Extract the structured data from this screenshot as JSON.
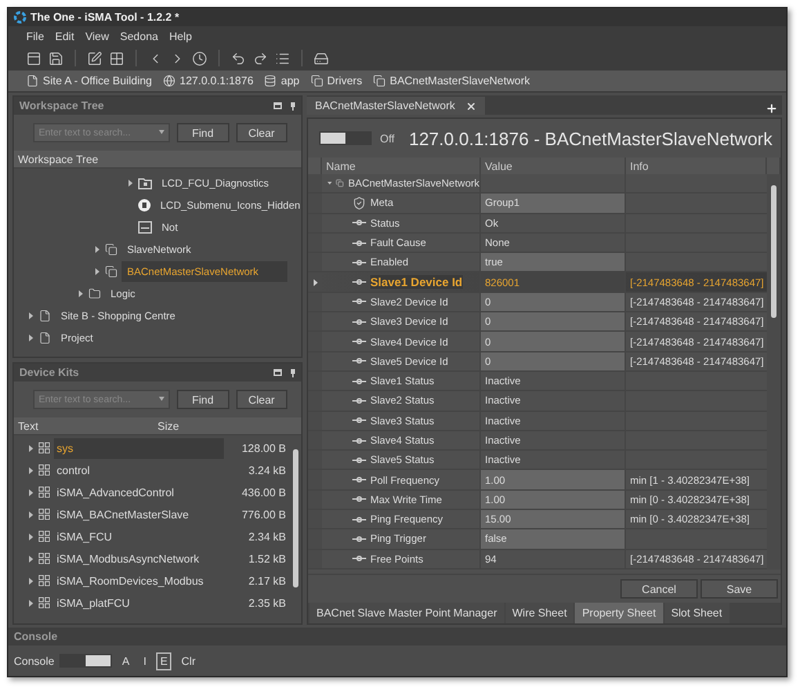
{
  "window": {
    "title": "The One - iSMA Tool - 1.2.2 *"
  },
  "menu": [
    {
      "label": "File"
    },
    {
      "label": "Edit"
    },
    {
      "label": "View"
    },
    {
      "label": "Sedona"
    },
    {
      "label": "Help"
    }
  ],
  "breadcrumb": [
    {
      "label": "Site A - Office Building",
      "kind": "file"
    },
    {
      "label": "127.0.0.1:1876",
      "kind": "device"
    },
    {
      "label": "app",
      "kind": "app"
    },
    {
      "label": "Drivers",
      "kind": "network"
    },
    {
      "label": "BACnetMasterSlaveNetwork",
      "kind": "network"
    }
  ],
  "workspace_tree": {
    "title": "Workspace Tree",
    "search": {
      "placeholder": "Enter text to search...",
      "find": "Find",
      "clear": "Clear"
    },
    "column": "Workspace Tree",
    "items": [
      {
        "children": [
          {
            "children": [
              {
                "children": [
                  {
                    "children": [
                      {
                        "children": [
                          {
                            "children": [
                              {
                                "label": "LCD_FCU_Diagnostics",
                                "kind": "folder-component",
                                "expandable": true,
                                "selected": false
                              },
                              {
                                "label": "LCD_Submenu_Icons_Hidden",
                                "kind": "badge",
                                "expandable": false,
                                "selected": false
                              },
                              {
                                "label": "Not",
                                "kind": "block",
                                "expandable": false,
                                "selected": false
                              }
                            ]
                          }
                        ]
                      },
                      {
                        "label": "SlaveNetwork",
                        "kind": "network",
                        "expandable": true,
                        "selected": false
                      },
                      {
                        "label": "BACnetMasterSlaveNetwork",
                        "kind": "network",
                        "expandable": true,
                        "selected": true
                      }
                    ]
                  },
                  {
                    "label": "Logic",
                    "kind": "folder",
                    "expandable": true,
                    "selected": false
                  }
                ]
              }
            ]
          }
        ]
      },
      {
        "label": "Site B - Shopping Centre",
        "kind": "file",
        "expandable": true,
        "selected": false
      },
      {
        "label": "Project",
        "kind": "file",
        "expandable": true,
        "selected": false
      }
    ]
  },
  "device_kits": {
    "title": "Device Kits",
    "search": {
      "placeholder": "Enter text to search...",
      "find": "Find",
      "clear": "Clear"
    },
    "columns": [
      "Text",
      "Size"
    ],
    "kits": [
      {
        "name": "sys",
        "size": "128.00 B",
        "selected": true
      },
      {
        "name": "control",
        "size": "3.24 kB",
        "selected": false
      },
      {
        "name": "iSMA_AdvancedControl",
        "size": "436.00 B",
        "selected": false
      },
      {
        "name": "iSMA_BACnetMasterSlave",
        "size": "776.00 B",
        "selected": false
      },
      {
        "name": "iSMA_FCU",
        "size": "2.34 kB",
        "selected": false
      },
      {
        "name": "iSMA_ModbusAsyncNetwork",
        "size": "1.52 kB",
        "selected": false
      },
      {
        "name": "iSMA_RoomDevices_Modbus",
        "size": "2.17 kB",
        "selected": false
      },
      {
        "name": "iSMA_platFCU",
        "size": "2.35 kB",
        "selected": false
      }
    ]
  },
  "editor": {
    "tabs": [
      {
        "label": "BACnetMasterSlaveNetwork",
        "selected": true
      }
    ],
    "toggle": {
      "label": "Off",
      "on": false
    },
    "heading": "127.0.0.1:1876 - BACnetMasterSlaveNetwork",
    "columns": [
      "Name",
      "Value",
      "Info"
    ],
    "rows": [
      {
        "kind": "component",
        "name": "BACnetMasterSlaveNetwork",
        "selected": false
      },
      {
        "kind": "meta",
        "name": "Meta",
        "value": "Group1",
        "editable": true,
        "selected": false
      },
      {
        "kind": "slot",
        "name": "Status",
        "value": "Ok",
        "editable": false,
        "selected": false
      },
      {
        "kind": "slot",
        "name": "Fault Cause",
        "value": "None",
        "editable": false,
        "selected": false
      },
      {
        "kind": "slot",
        "name": "Enabled",
        "value": "true",
        "editable": true,
        "selected": false
      },
      {
        "kind": "slot",
        "name": "Slave1 Device Id",
        "value": "826001",
        "info": "[-2147483648 - 2147483647]",
        "editable": true,
        "selected": true
      },
      {
        "kind": "slot",
        "name": "Slave2 Device Id",
        "value": "0",
        "info": "[-2147483648 - 2147483647]",
        "editable": true,
        "selected": false
      },
      {
        "kind": "slot",
        "name": "Slave3 Device Id",
        "value": "0",
        "info": "[-2147483648 - 2147483647]",
        "editable": true,
        "selected": false
      },
      {
        "kind": "slot",
        "name": "Slave4 Device Id",
        "value": "0",
        "info": "[-2147483648 - 2147483647]",
        "editable": true,
        "selected": false
      },
      {
        "kind": "slot",
        "name": "Slave5 Device Id",
        "value": "0",
        "info": "[-2147483648 - 2147483647]",
        "editable": true,
        "selected": false
      },
      {
        "kind": "slot",
        "name": "Slave1 Status",
        "value": "Inactive",
        "editable": false,
        "selected": false
      },
      {
        "kind": "slot",
        "name": "Slave2 Status",
        "value": "Inactive",
        "editable": false,
        "selected": false
      },
      {
        "kind": "slot",
        "name": "Slave3 Status",
        "value": "Inactive",
        "editable": false,
        "selected": false
      },
      {
        "kind": "slot",
        "name": "Slave4 Status",
        "value": "Inactive",
        "editable": false,
        "selected": false
      },
      {
        "kind": "slot",
        "name": "Slave5 Status",
        "value": "Inactive",
        "editable": false,
        "selected": false
      },
      {
        "kind": "slot",
        "name": "Poll Frequency",
        "value": "1.00",
        "info": "min  [1 - 3.40282347E+38]",
        "editable": true,
        "selected": false
      },
      {
        "kind": "slot",
        "name": "Max Write Time",
        "value": "1.00",
        "info": "min  [0 - 3.40282347E+38]",
        "editable": true,
        "selected": false
      },
      {
        "kind": "slot",
        "name": "Ping Frequency",
        "value": "15.00",
        "info": "min  [0 - 3.40282347E+38]",
        "editable": true,
        "selected": false
      },
      {
        "kind": "slot",
        "name": "Ping Trigger",
        "value": "false",
        "editable": true,
        "selected": false
      },
      {
        "kind": "slot",
        "name": "Free Points",
        "value": "94",
        "info": "[-2147483648 - 2147483647]",
        "editable": false,
        "selected": false
      }
    ],
    "buttons": [
      "Cancel",
      "Save"
    ],
    "view_tabs": [
      {
        "label": "BACnet Slave Master Point Manager",
        "selected": false
      },
      {
        "label": "Wire Sheet",
        "selected": false
      },
      {
        "label": "Property Sheet",
        "selected": true
      },
      {
        "label": "Slot Sheet",
        "selected": false
      }
    ]
  },
  "console": {
    "title": "Console",
    "label": "Console",
    "switch": {
      "on": true
    },
    "filters": [
      {
        "label": "A",
        "selected": false
      },
      {
        "label": "I",
        "selected": false
      },
      {
        "label": "E",
        "selected": true
      }
    ],
    "clear": "Clr"
  }
}
